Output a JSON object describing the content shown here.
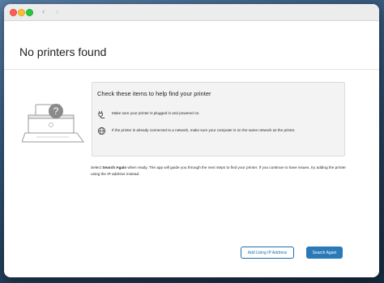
{
  "window": {
    "controls": {
      "close": "close-button",
      "minimize": "minimize-button",
      "maximize": "maximize-button"
    },
    "nav": {
      "back_glyph": "‹",
      "forward_glyph": "›"
    }
  },
  "page": {
    "title": "No printers found"
  },
  "checklist": {
    "title": "Check these items to help find your printer",
    "items": [
      {
        "icon": "power-plug-icon",
        "text": "Make sure your printer is plugged in and powered on."
      },
      {
        "icon": "network-globe-icon",
        "text": "If the printer is already connected to a network, make sure your computer is on the same network as the printer."
      }
    ]
  },
  "instructions": {
    "prefix": "Select ",
    "emphasis": "Search Again",
    "suffix": " when ready. The app will guide you through the next steps to find your printer. If you continue to have issues, try adding the printer using the IP address instead."
  },
  "buttons": {
    "add_ip": "Add Using IP Address",
    "search_again": "Search Again"
  },
  "colors": {
    "accent": "#2a7ab8",
    "close": "#fe5f57",
    "minimize": "#febc2e",
    "maximize": "#28c840"
  }
}
